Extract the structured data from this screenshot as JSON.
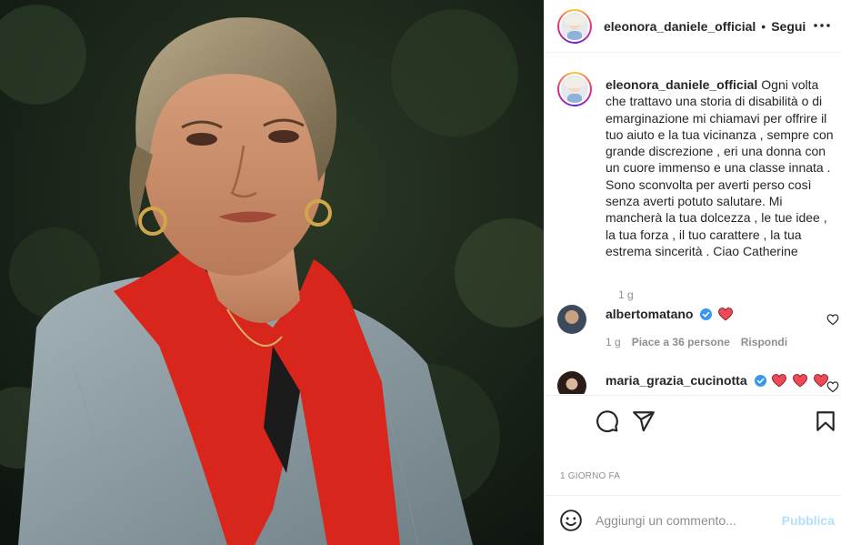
{
  "post": {
    "photo_alt": "",
    "username": "eleonora_daniele_official",
    "separator": "•",
    "follow_label": "Segui",
    "caption": "Ogni volta che trattavo una storia di disabilità o di emarginazione mi chiamavi per offrire il tuo aiuto e la tua vicinanza , sempre con grande discrezione , eri una donna con un cuore immenso e una classe innata . Sono sconvolta per averti perso così senza averti potuto salutare. Mi mancherà la tua dolcezza , le tue idee , la tua forza , il tuo carattere , la tua estrema sincerità . Ciao Catherine",
    "caption_time": "1 g",
    "date_label": "1 GIORNO FA"
  },
  "comments": [
    {
      "username": "albertomatano",
      "verified": true,
      "text_icons": [
        "heart-emoji"
      ],
      "time": "1 g",
      "likes_label": "Piace a 36 persone",
      "reply_label": "Rispondi"
    },
    {
      "username": "maria_grazia_cucinotta",
      "verified": true,
      "text_icons": [
        "heart-emoji",
        "heart-emoji",
        "heart-emoji"
      ]
    }
  ],
  "composer": {
    "placeholder": "Aggiungi un commento...",
    "publish_label": "Pubblica"
  },
  "icons": {
    "more": "more-options-icon",
    "comment": "comment-icon",
    "share": "share-icon",
    "save": "bookmark-icon",
    "emoji": "emoji-icon",
    "like": "heart-outline-icon"
  },
  "colors": {
    "text": "#262626",
    "muted": "#8e8e8e",
    "verified": "#3897f0",
    "heart": "#ed4956",
    "publish_disabled": "#b2dffc"
  }
}
